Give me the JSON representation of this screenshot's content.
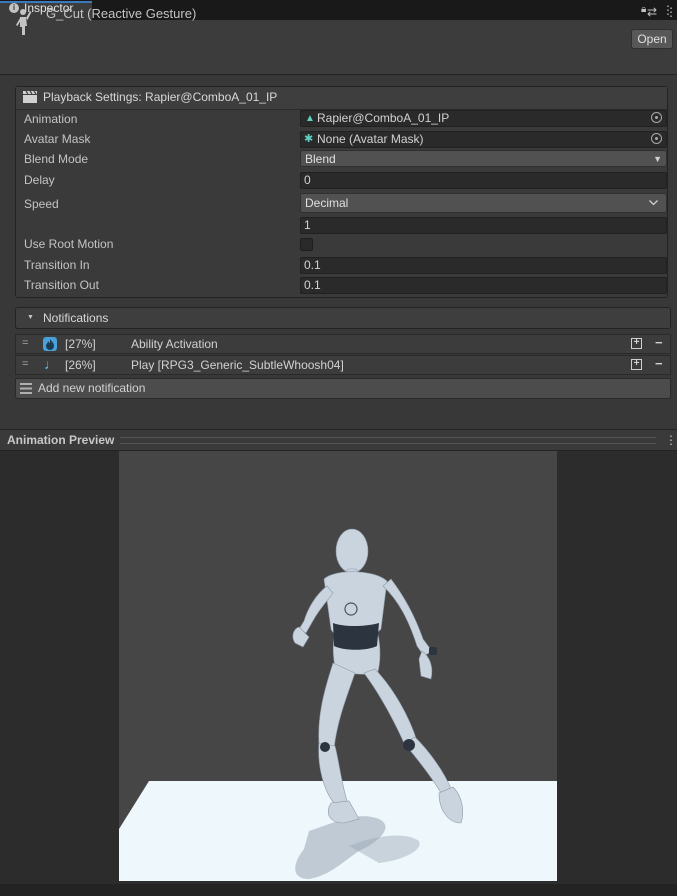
{
  "tab": {
    "label": "Inspector",
    "info_icon": "info-icon",
    "lock_icon": "lock-icon",
    "menu_icon": "kebab-menu-icon"
  },
  "header": {
    "title": "G_Cut (Reactive Gesture)",
    "icon": "gesture-figure-icon",
    "open_button": "Open"
  },
  "playback": {
    "title": "Playback Settings: Rapier@ComboA_01_IP",
    "animation_label": "Animation",
    "animation_value": "Rapier@ComboA_01_IP",
    "avatar_mask_label": "Avatar Mask",
    "avatar_mask_value": "None (Avatar Mask)",
    "blend_mode_label": "Blend Mode",
    "blend_mode_value": "Blend",
    "delay_label": "Delay",
    "delay_value": "0",
    "speed_label": "Speed",
    "speed_value": "Decimal",
    "speed_number": "1",
    "use_root_motion_label": "Use Root Motion",
    "use_root_motion_checked": false,
    "transition_in_label": "Transition In",
    "transition_in_value": "0.1",
    "transition_out_label": "Transition Out",
    "transition_out_value": "0.1"
  },
  "notifications": {
    "title": "Notifications",
    "items": [
      {
        "percent": "[27%]",
        "name": "Ability Activation",
        "icon": "flame-icon"
      },
      {
        "percent": "[26%]",
        "name": "Play [RPG3_Generic_SubtleWhoosh04]",
        "icon": "music-note-icon"
      }
    ],
    "add_label": "Add new notification"
  },
  "preview": {
    "title": "Animation Preview"
  },
  "colors": {
    "accent": "#3a79bb",
    "icon_blue": "#4aa0d8",
    "background": "#383838"
  }
}
